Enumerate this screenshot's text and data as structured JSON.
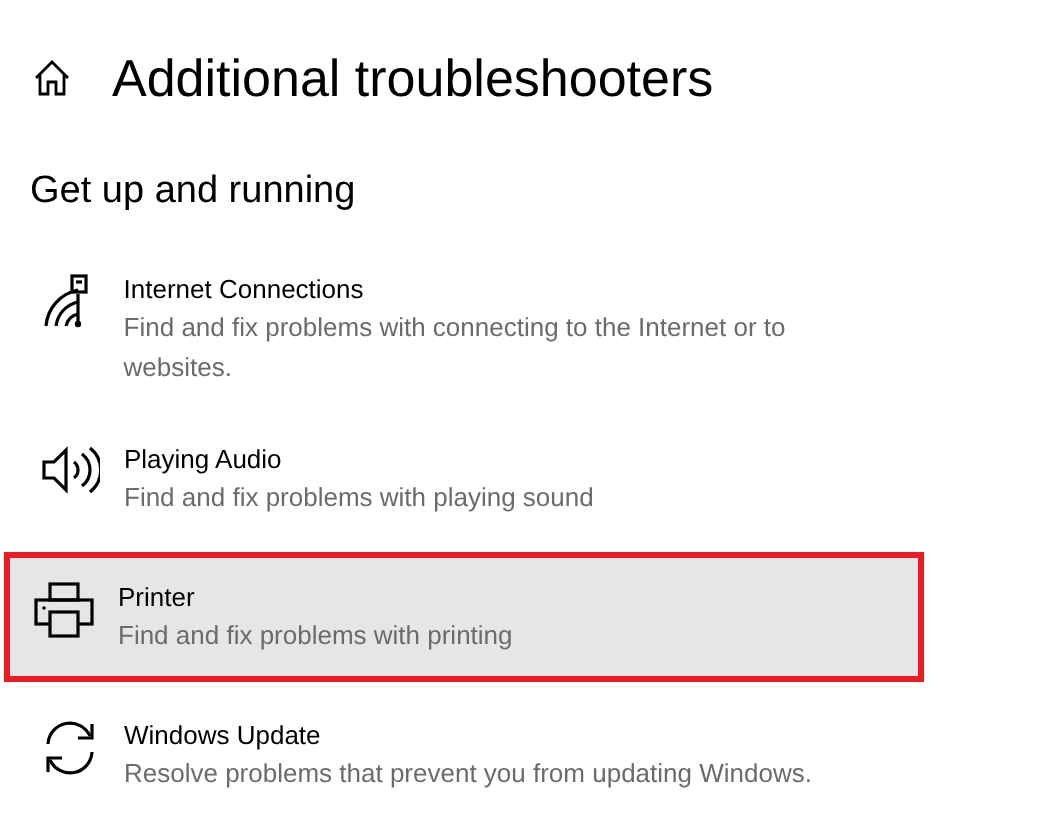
{
  "page": {
    "title": "Additional troubleshooters"
  },
  "section": {
    "heading": "Get up and running"
  },
  "items": [
    {
      "kind": "network",
      "title": "Internet Connections",
      "description": "Find and fix problems with connecting to the Internet or to websites.",
      "selected": false
    },
    {
      "kind": "audio",
      "title": "Playing Audio",
      "description": "Find and fix problems with playing sound",
      "selected": false
    },
    {
      "kind": "printer",
      "title": "Printer",
      "description": "Find and fix problems with printing",
      "selected": true
    },
    {
      "kind": "update",
      "title": "Windows Update",
      "description": "Resolve problems that prevent you from updating Windows.",
      "selected": false
    }
  ]
}
